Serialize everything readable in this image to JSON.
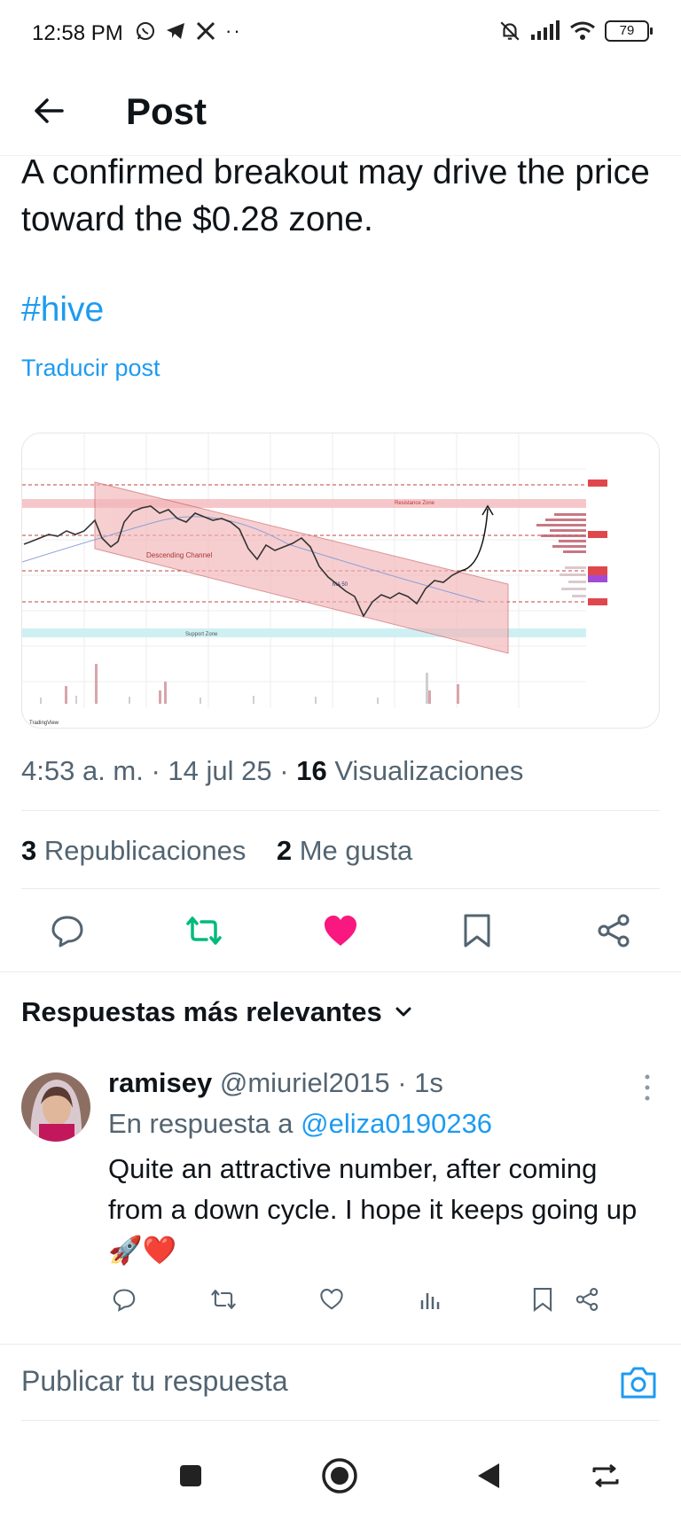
{
  "status_bar": {
    "time": "12:58 PM",
    "left_icons": [
      "whatsapp-icon",
      "telegram-icon",
      "x-icon",
      "more-dots-icon"
    ],
    "right_icons": [
      "mute-bell-icon",
      "signal-icon",
      "wifi-icon",
      "battery-icon"
    ],
    "battery": "79"
  },
  "header": {
    "title": "Post"
  },
  "post": {
    "text": "A confirmed breakout may drive the price toward the $0.28 zone.",
    "hashtag": "#hive",
    "translate": "Traducir post",
    "chart_image": {
      "labels": {
        "resistance": "Resistance Zone",
        "channel": "Descending Channel",
        "ma": "MA 50",
        "support": "Support Zone",
        "brand": "TradingView"
      }
    },
    "meta": {
      "time": "4:53 a. m.",
      "sep1": " · ",
      "date": "14 jul 25",
      "sep2": " · ",
      "views_count": "16",
      "views_label": "Visualizaciones"
    },
    "stats": {
      "reposts_count": "3",
      "reposts_label": "Republicaciones",
      "likes_count": "2",
      "likes_label": "Me gusta"
    },
    "accent_color": "#1d9bf0",
    "like_color": "#f91880",
    "repost_color": "#00ba7c"
  },
  "replies_sort": {
    "label": "Respuestas más relevantes"
  },
  "reply": {
    "name": "ramisey",
    "handle": "@miuriel2015",
    "time": " · 1s",
    "in_reply_prefix": "En respuesta a ",
    "in_reply_handle": "@eliza0190236",
    "text": "Quite an attractive number, after coming from a down cycle. I hope it keeps going up 🚀❤️"
  },
  "compose": {
    "placeholder": "Publicar tu respuesta"
  }
}
